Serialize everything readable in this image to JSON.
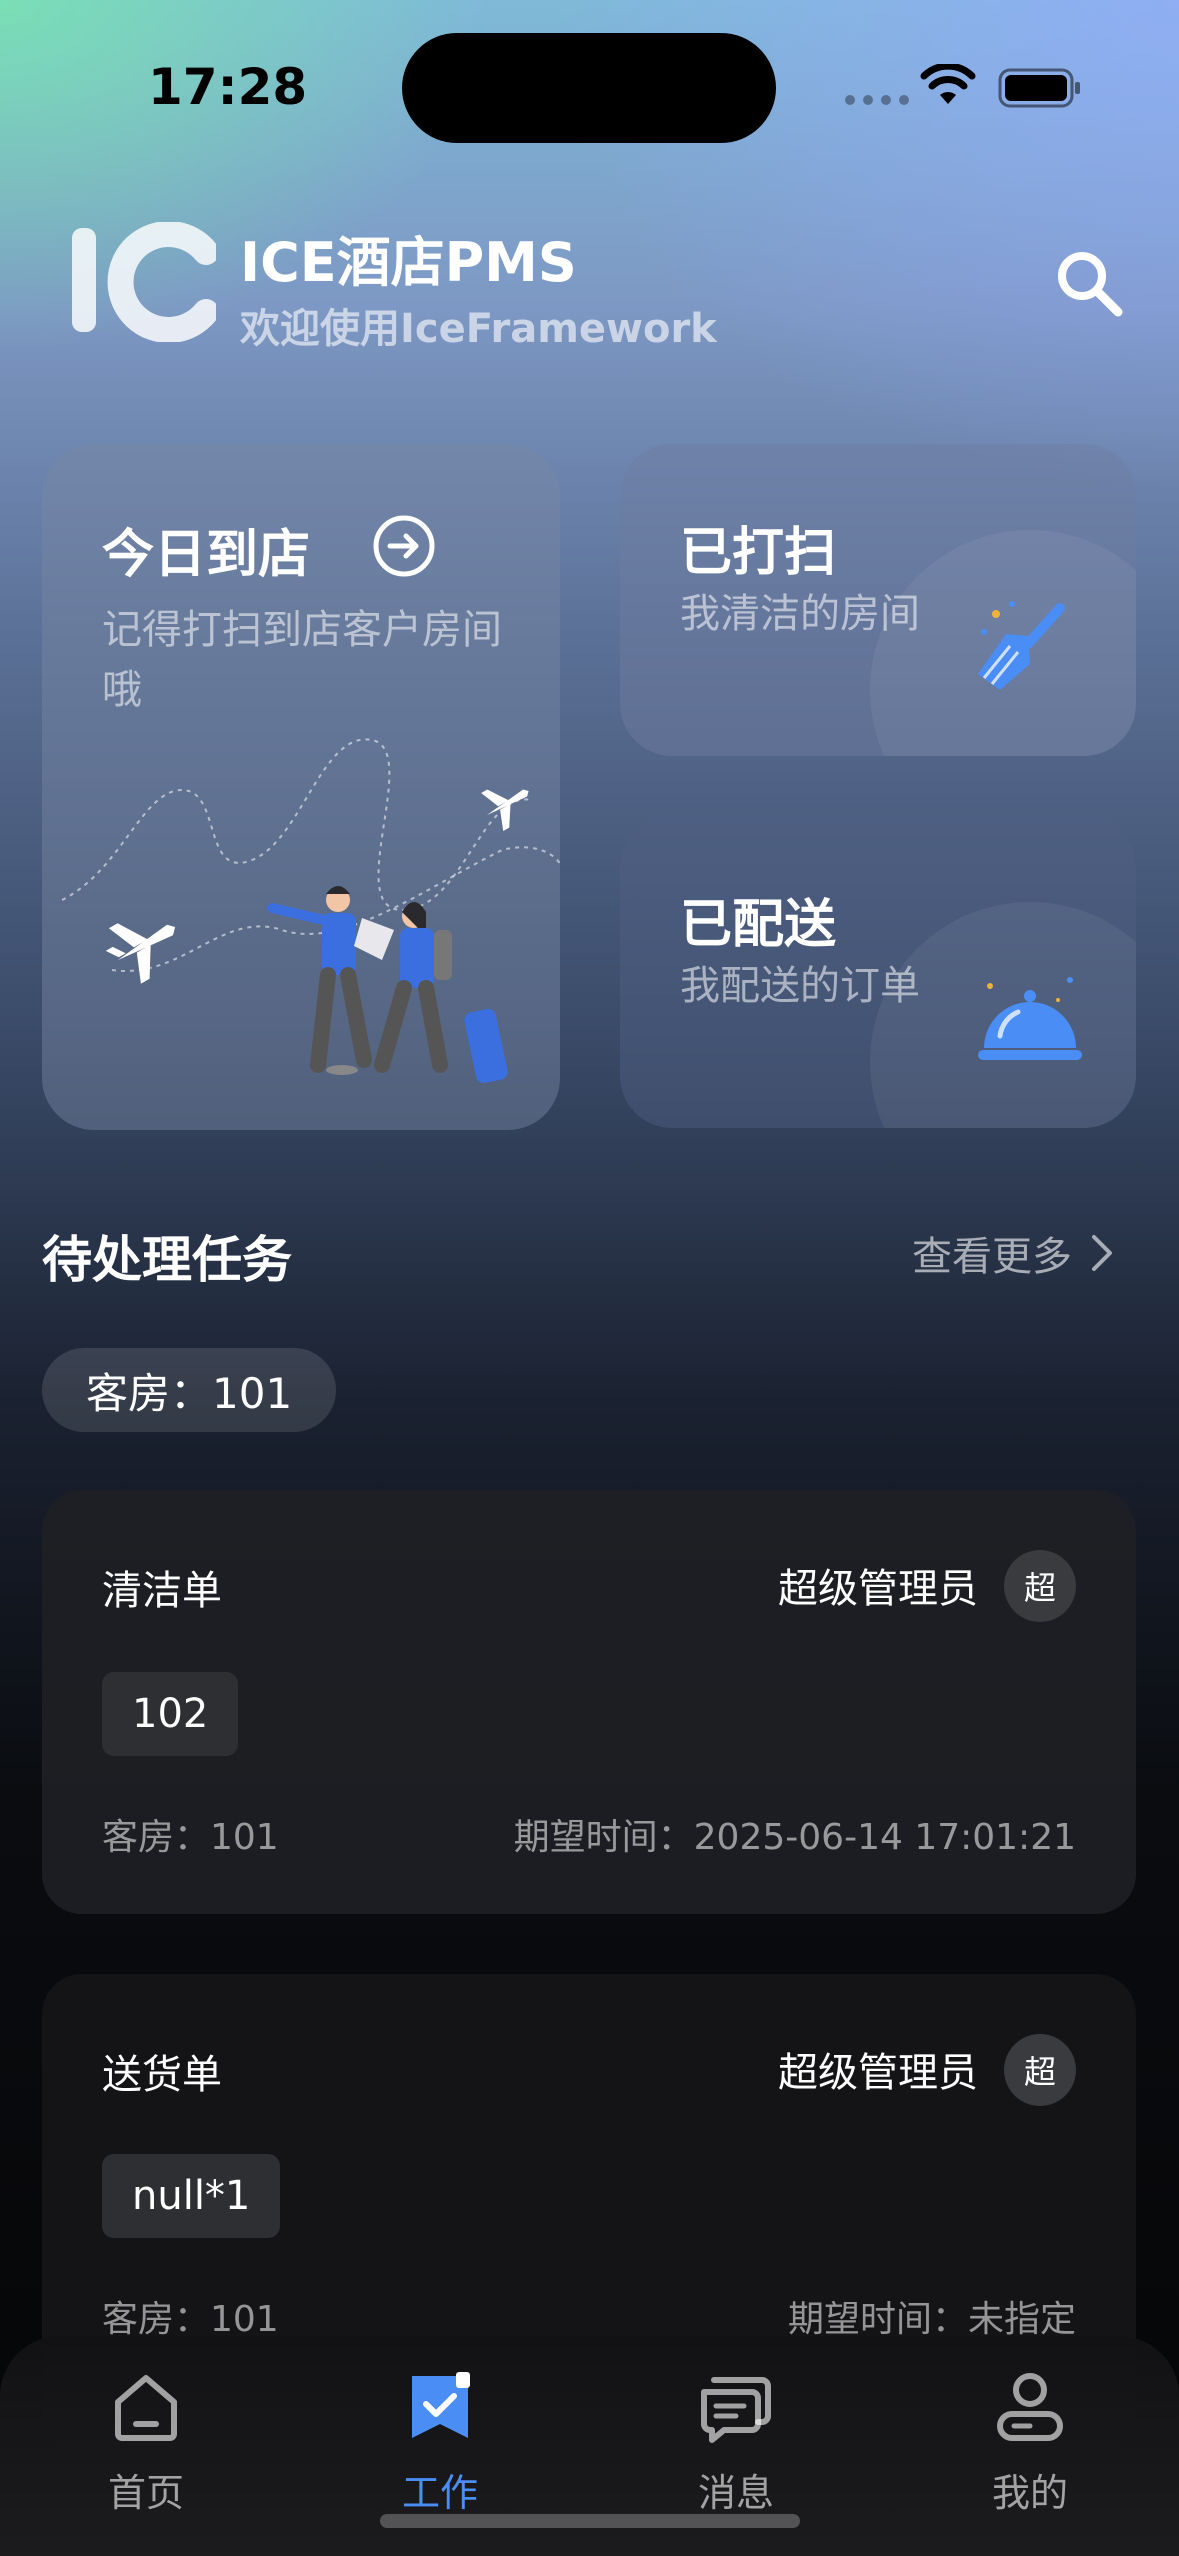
{
  "status_bar": {
    "time": "17:28"
  },
  "header": {
    "logo_text": "IC",
    "title": "ICE酒店PMS",
    "subtitle": "欢迎使用IceFramework"
  },
  "cards": {
    "checkin": {
      "title": "今日到店",
      "subtitle": "记得打扫到店客户房间哦"
    },
    "cleaned": {
      "title": "已打扫",
      "subtitle": "我清洁的房间"
    },
    "delivered": {
      "title": "已配送",
      "subtitle": "我配送的订单"
    }
  },
  "section": {
    "title": "待处理任务",
    "view_more": "查看更多"
  },
  "filter_chip": "客房：101",
  "tasks": [
    {
      "type": "清洁单",
      "assignee": "超级管理员",
      "avatar": "超",
      "tag": "102",
      "room": "客房：101",
      "time": "期望时间：2025-06-14 17:01:21"
    },
    {
      "type": "送货单",
      "assignee": "超级管理员",
      "avatar": "超",
      "tag": "null*1",
      "room": "客房：101",
      "time": "期望时间：未指定"
    }
  ],
  "tab_bar": {
    "items": [
      {
        "label": "首页",
        "icon": "home-icon",
        "active": false
      },
      {
        "label": "工作",
        "icon": "work-icon",
        "active": true
      },
      {
        "label": "消息",
        "icon": "message-icon",
        "active": false
      },
      {
        "label": "我的",
        "icon": "profile-icon",
        "active": false
      }
    ]
  },
  "colors": {
    "accent": "#4a8ef5",
    "card_dark": "#17181b"
  }
}
